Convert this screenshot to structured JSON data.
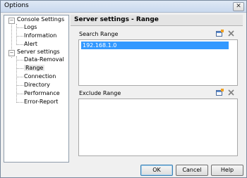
{
  "window": {
    "title": "Options",
    "close_glyph": "✕"
  },
  "tree": {
    "items": [
      {
        "label": "Console Settings",
        "toggle": "−"
      },
      {
        "label": "Logs"
      },
      {
        "label": "Information"
      },
      {
        "label": "Alert"
      },
      {
        "label": "Server settings",
        "toggle": "−"
      },
      {
        "label": "Data-Removal"
      },
      {
        "label": "Range",
        "selected": true
      },
      {
        "label": "Connection"
      },
      {
        "label": "Directory"
      },
      {
        "label": "Performance"
      },
      {
        "label": "Error-Report"
      }
    ]
  },
  "panel": {
    "title": "Server settings - Range",
    "search": {
      "label": "Search Range",
      "items": [
        "192.168.1.0"
      ]
    },
    "exclude": {
      "label": "Exclude Range",
      "items": []
    }
  },
  "buttons": {
    "ok": "OK",
    "cancel": "Cancel",
    "help": "Help"
  },
  "icons": {
    "add": "add-range-icon",
    "delete": "delete-x-icon"
  }
}
